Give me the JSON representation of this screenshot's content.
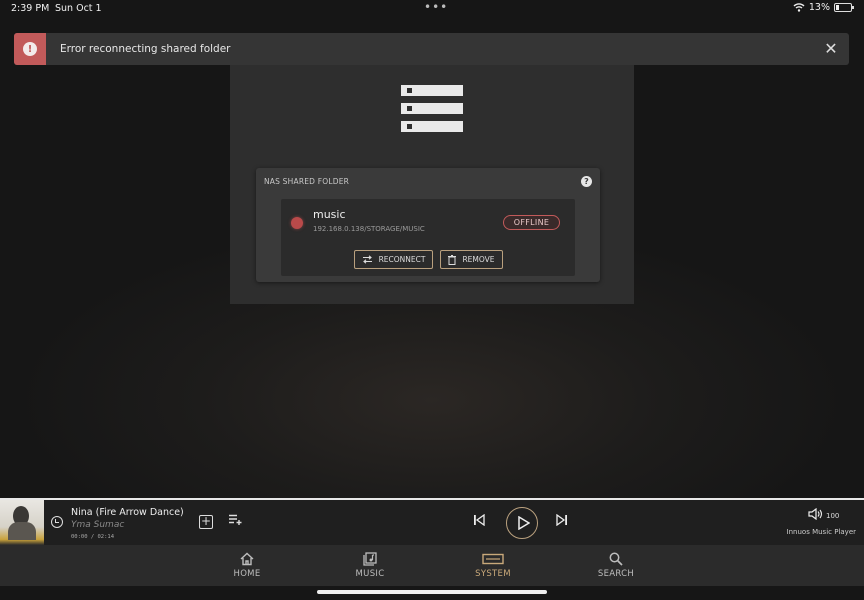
{
  "status_bar": {
    "time": "2:39 PM",
    "date": "Sun Oct 1",
    "battery": "13%"
  },
  "error_banner": {
    "message": "Error reconnecting shared folder",
    "icon": "exclamation-icon",
    "color": "#c25a5a"
  },
  "nas_card": {
    "title": "NAS SHARED FOLDER",
    "share": {
      "name": "music",
      "path": "192.168.0.138/STORAGE/MUSIC",
      "status": "OFFLINE"
    },
    "buttons": {
      "reconnect": "RECONNECT",
      "remove": "REMOVE"
    }
  },
  "player": {
    "track_title": "Nina (Fire Arrow Dance)",
    "artist": "Yma Sumac",
    "time": "00:00 / 02:14",
    "volume": "100",
    "device": "Innuos Music Player",
    "accent": "#b9a07e"
  },
  "nav": {
    "home": "HOME",
    "music": "MUSIC",
    "system": "SYSTEM",
    "search": "SEARCH",
    "active": "SYSTEM",
    "active_color": "#c9a97a"
  }
}
